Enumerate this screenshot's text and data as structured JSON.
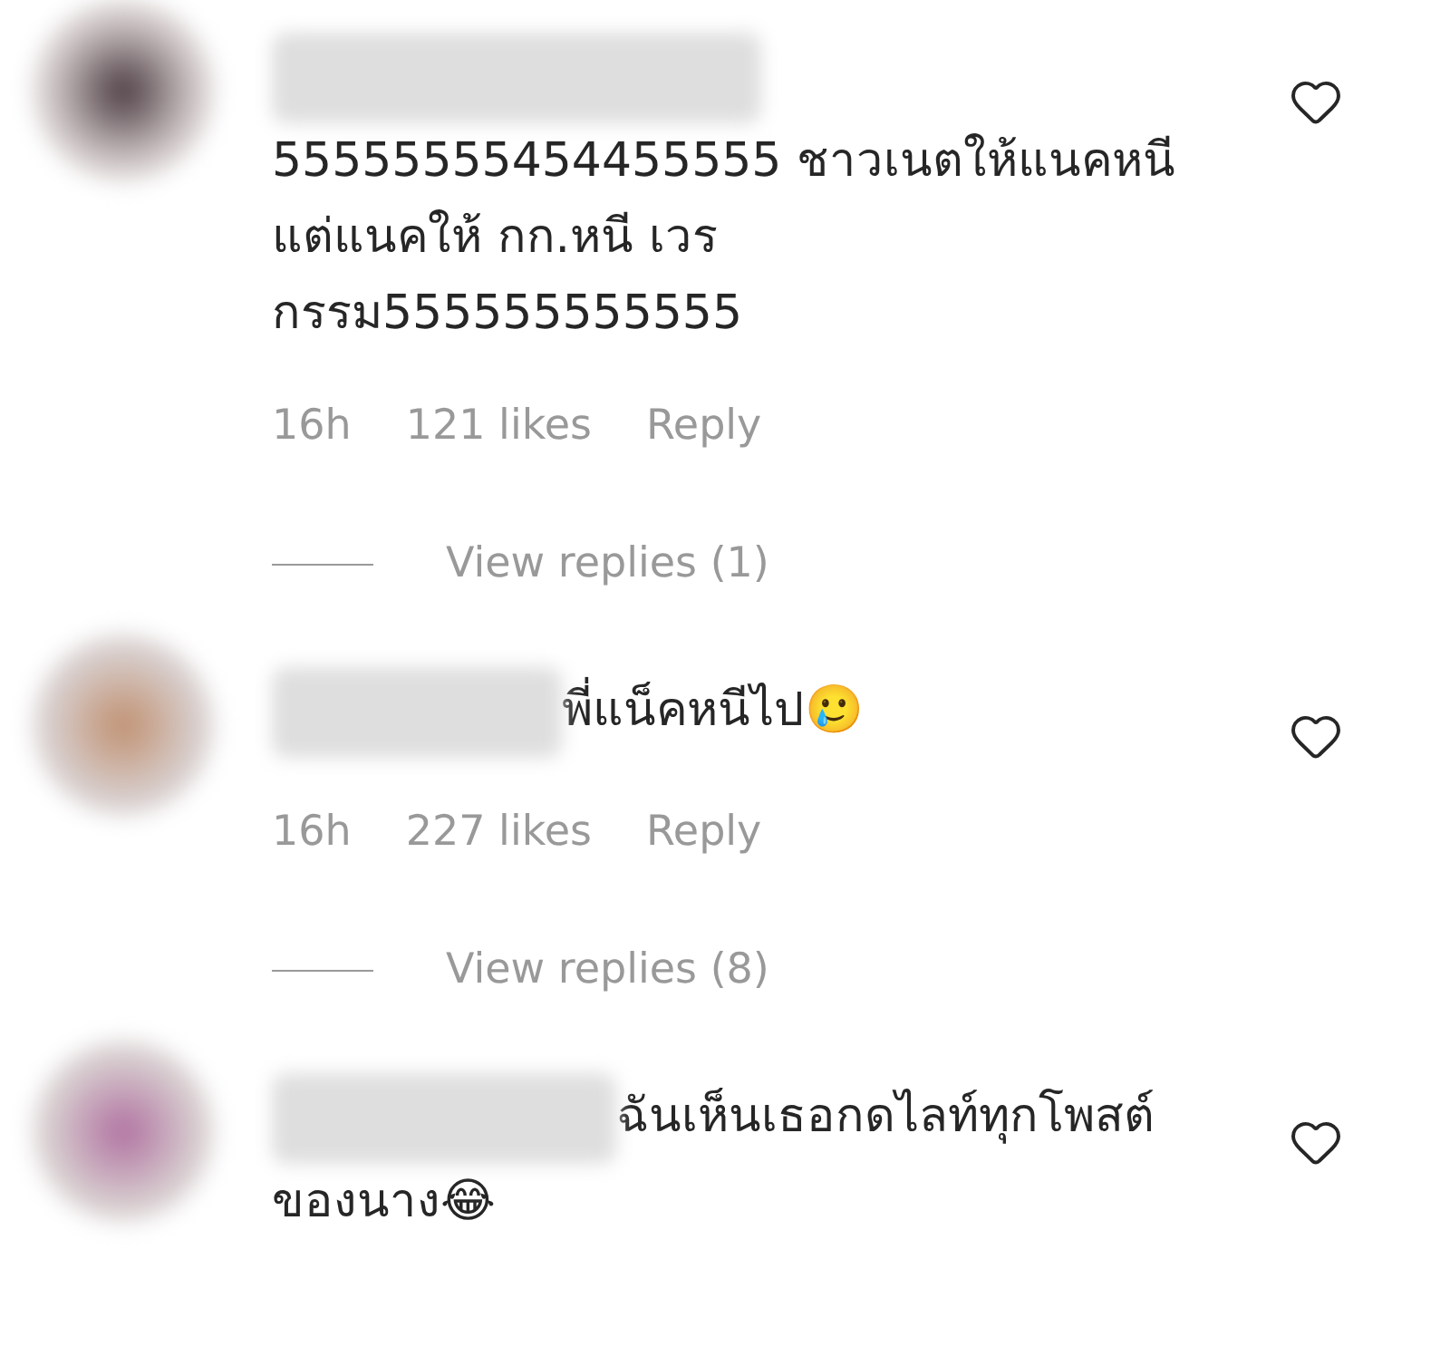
{
  "comments": [
    {
      "text": "55555555454455555 ชาวเนตให้แนคหนี แต่แนคให้ กก.หนี เวรกรรม555555555555",
      "time": "16h",
      "likes": "121 likes",
      "reply": "Reply",
      "view_replies": "View replies (1)"
    },
    {
      "text": "พี่แน็คหนีไป🥲",
      "time": "16h",
      "likes": "227 likes",
      "reply": "Reply",
      "view_replies": "View replies (8)"
    },
    {
      "text": "ฉันเห็นเธอกดไลท์ทุกโพสต์ของนาง😂"
    }
  ]
}
